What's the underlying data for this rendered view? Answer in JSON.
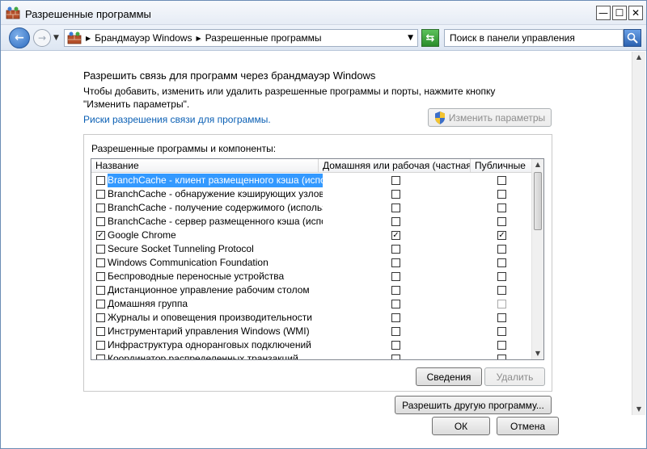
{
  "window": {
    "title": "Разрешенные программы"
  },
  "titlebar_buttons": {
    "minimize": "—",
    "maximize": "☐",
    "close": "✕"
  },
  "address": {
    "crumbs": [
      "Брандмауэр Windows",
      "Разрешенные программы"
    ],
    "search_value": "Поиск в панели управления"
  },
  "main": {
    "heading": "Разрешить связь для программ через брандмауэр Windows",
    "subtext": "Чтобы добавить, изменить или удалить разрешенные программы и порты, нажмите кнопку \"Изменить параметры\".",
    "risks_link": "Риски разрешения связи для программы.",
    "change_settings_label": "Изменить параметры",
    "group_label": "Разрешенные программы и компоненты:",
    "columns": {
      "name": "Название",
      "home": "Домашняя или рабочая (частная)",
      "public": "Публичные"
    },
    "rows": [
      {
        "name": "BranchCache - клиент размещенного кэша (испо...",
        "enabled": false,
        "home": false,
        "public": false,
        "selected": true
      },
      {
        "name": "BranchCache - обнаружение кэширующих узлов ...",
        "enabled": false,
        "home": false,
        "public": false
      },
      {
        "name": "BranchCache - получение содержимого (использ...",
        "enabled": false,
        "home": false,
        "public": false
      },
      {
        "name": "BranchCache - сервер размещенного кэша (испол...",
        "enabled": false,
        "home": false,
        "public": false
      },
      {
        "name": "Google Chrome",
        "enabled": true,
        "home": true,
        "public": true
      },
      {
        "name": "Secure Socket Tunneling Protocol",
        "enabled": false,
        "home": false,
        "public": false
      },
      {
        "name": "Windows Communication Foundation",
        "enabled": false,
        "home": false,
        "public": false
      },
      {
        "name": "Беспроводные переносные устройства",
        "enabled": false,
        "home": false,
        "public": false
      },
      {
        "name": "Дистанционное управление рабочим столом",
        "enabled": false,
        "home": false,
        "public": false
      },
      {
        "name": "Домашняя группа",
        "enabled": false,
        "home": false,
        "public": false
      },
      {
        "name": "Журналы и оповещения производительности",
        "enabled": false,
        "home": false,
        "public": false
      },
      {
        "name": "Инструментарий управления Windows (WMI)",
        "enabled": false,
        "home": false,
        "public": false
      },
      {
        "name": "Инфраструктура одноранговых подключений",
        "enabled": false,
        "home": false,
        "public": false
      },
      {
        "name": "Координатор распределенных транзакций",
        "enabled": false,
        "home": false,
        "public": false
      }
    ],
    "details_label": "Сведения",
    "remove_label": "Удалить",
    "allow_other_label": "Разрешить другую программу...",
    "ok_label": "ОК",
    "cancel_label": "Отмена"
  },
  "colors": {
    "link": "#0a5fb4",
    "selection": "#3399ff"
  }
}
